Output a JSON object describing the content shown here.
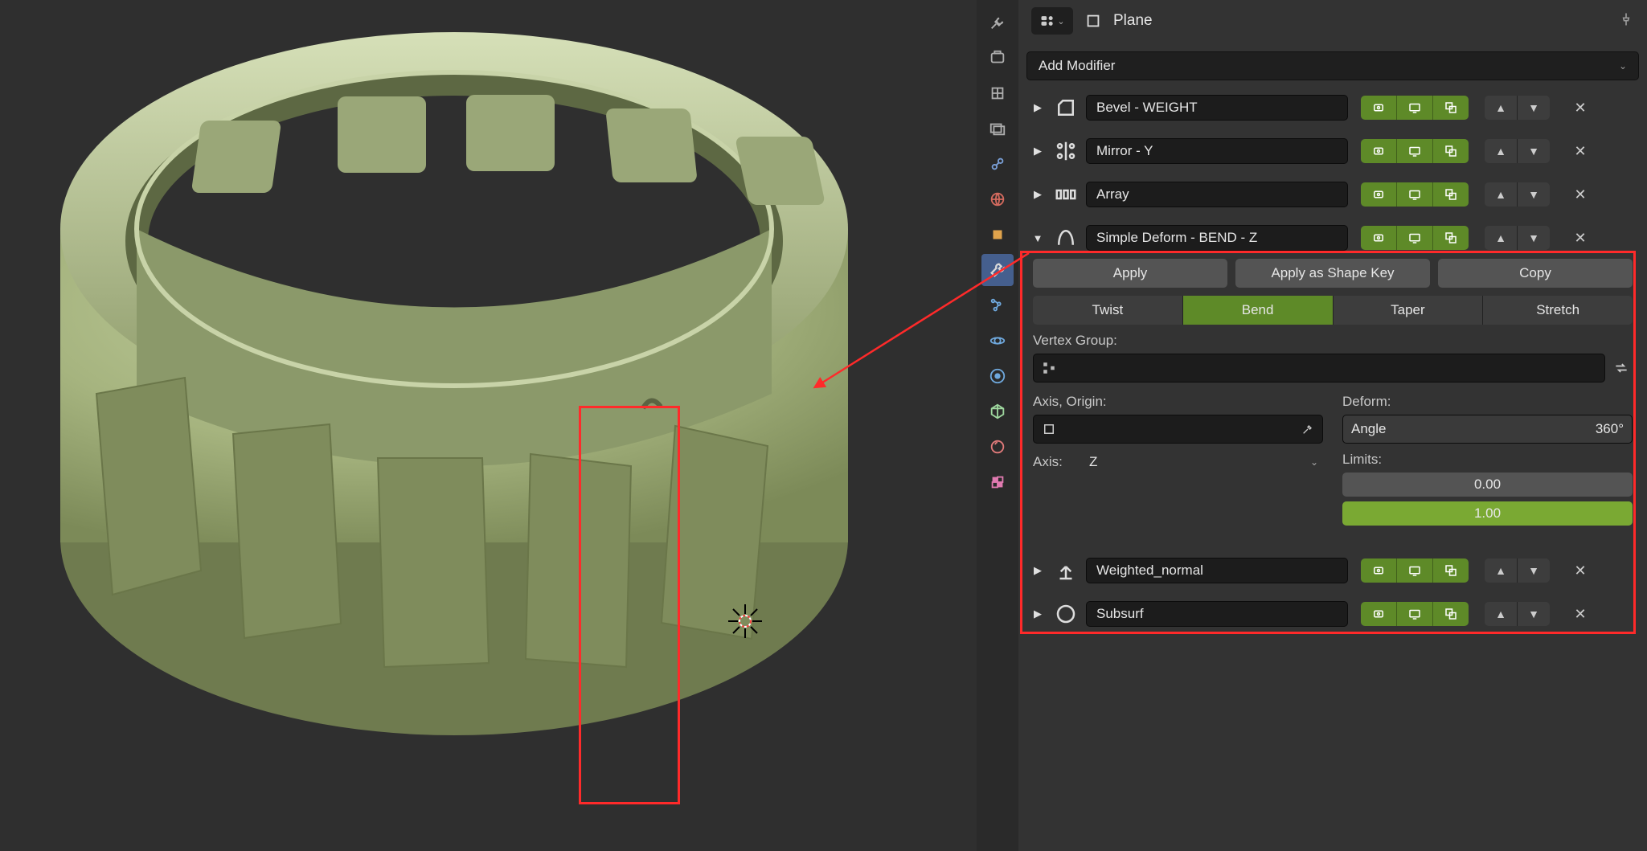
{
  "header": {
    "object_name": "Plane"
  },
  "add_modifier_label": "Add Modifier",
  "modifiers": {
    "bevel": {
      "name": "Bevel - WEIGHT"
    },
    "mirror": {
      "name": "Mirror - Y"
    },
    "array": {
      "name": "Array"
    },
    "simple_deform": {
      "name": "Simple Deform - BEND - Z",
      "apply_label": "Apply",
      "apply_shape_label": "Apply as Shape Key",
      "copy_label": "Copy",
      "modes": {
        "twist": "Twist",
        "bend": "Bend",
        "taper": "Taper",
        "stretch": "Stretch"
      },
      "vertex_group_label": "Vertex Group:",
      "vertex_group_value": "",
      "axis_origin_label": "Axis, Origin:",
      "origin_object": "",
      "axis_label": "Axis:",
      "axis_value": "Z",
      "deform_label": "Deform:",
      "angle_label": "Angle",
      "angle_value": "360°",
      "limits_label": "Limits:",
      "limit_low": "0.00",
      "limit_high": "1.00"
    },
    "weighted_normal": {
      "name": "Weighted_normal"
    },
    "subsurf": {
      "name": "Subsurf"
    }
  },
  "icons": {
    "expand": "▶",
    "expand_open": "▼",
    "chevron_down": "⌄",
    "close": "✕",
    "up": "▲",
    "down": "▼"
  },
  "colors": {
    "accent_green": "#5e8a28",
    "highlight_red": "#ff2a2a",
    "olive_material": "#a6b47f"
  }
}
